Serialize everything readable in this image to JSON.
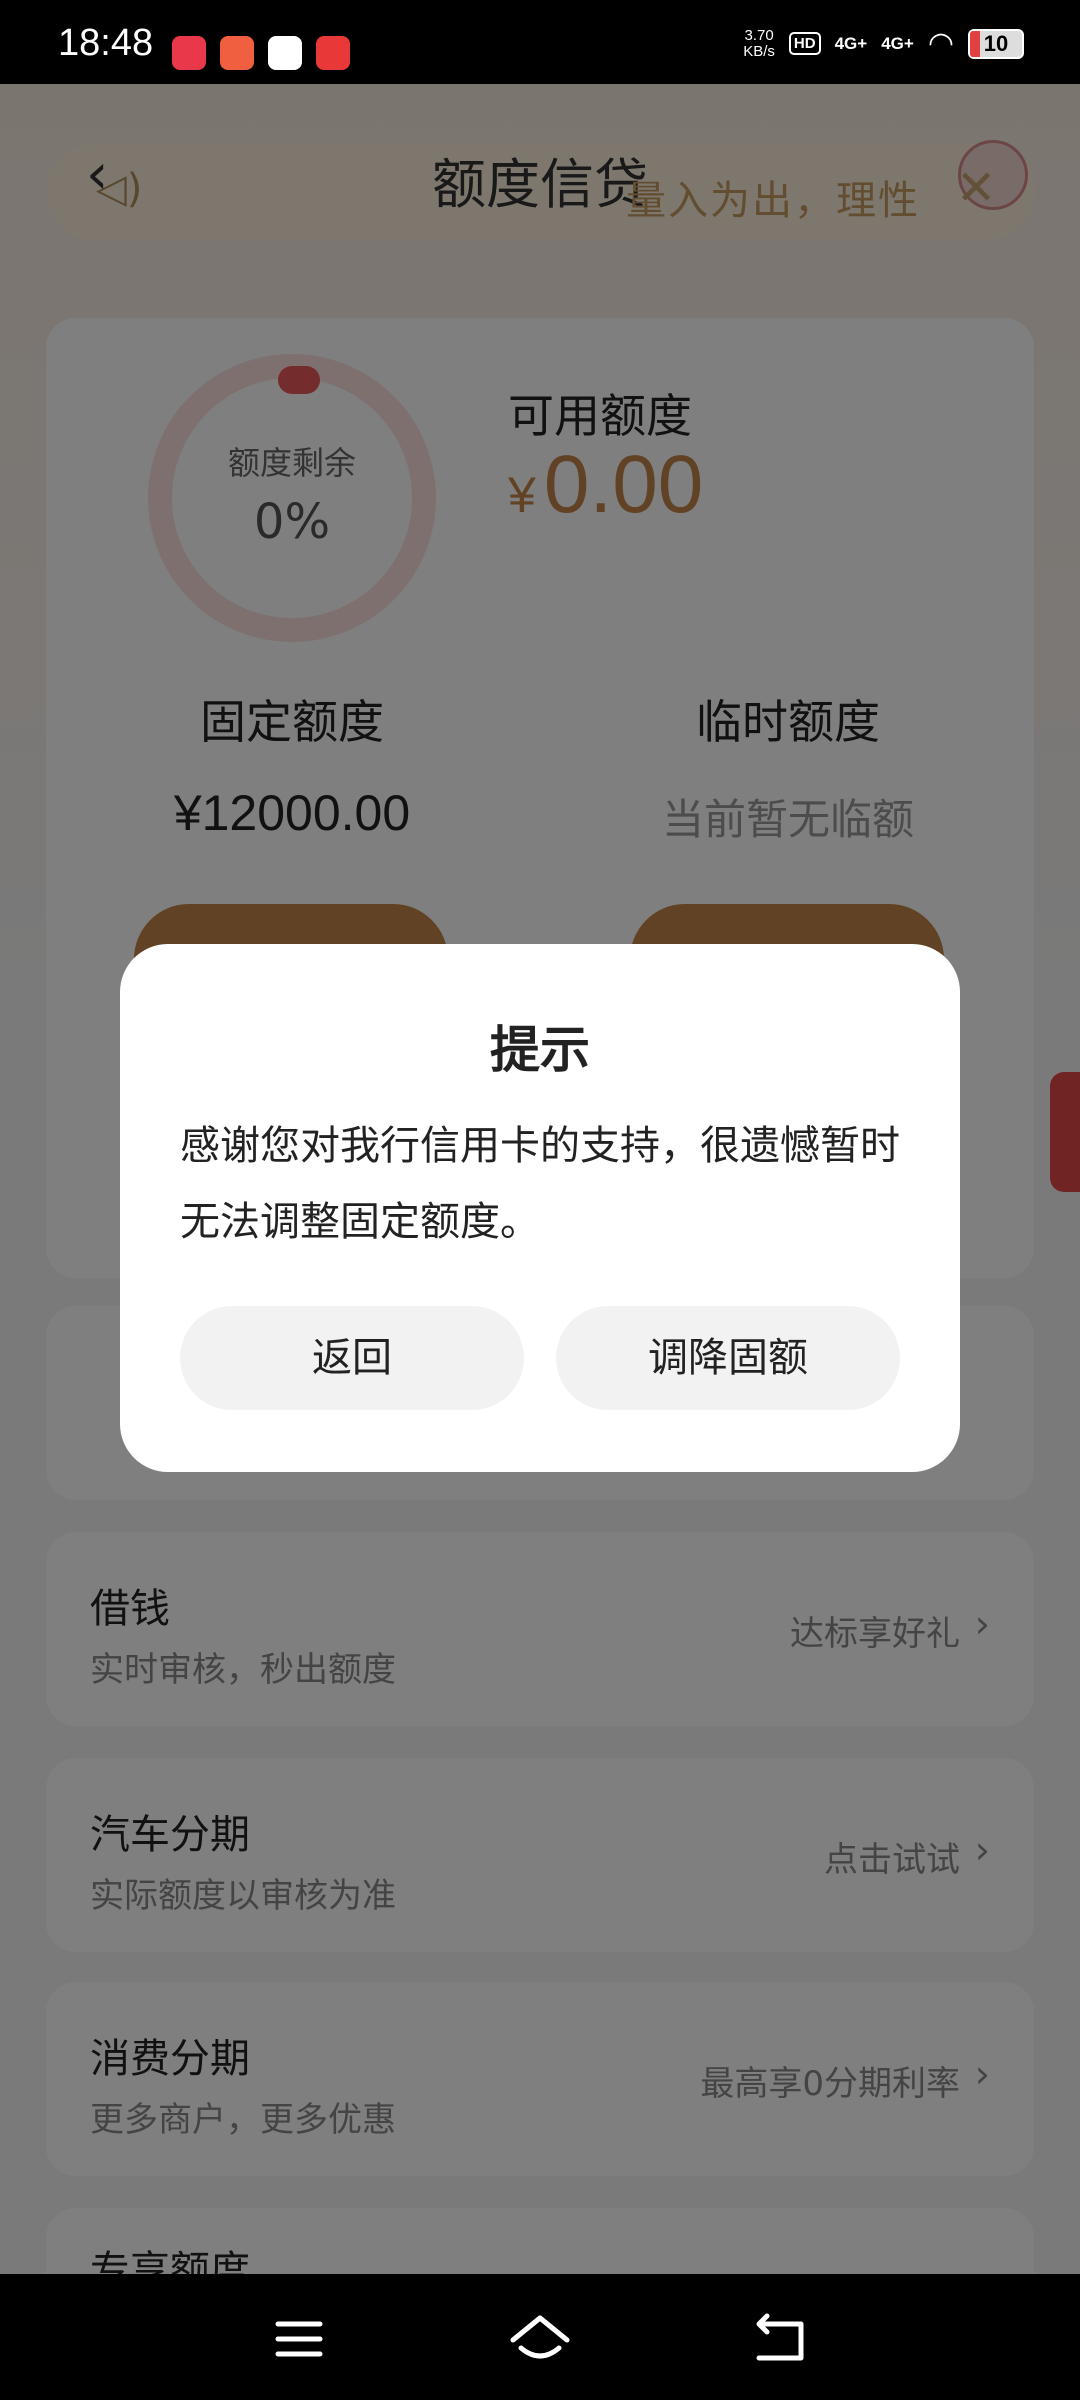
{
  "status_bar": {
    "time": "18:48",
    "speed_value": "3.70",
    "speed_unit": "KB/s",
    "hd": "HD",
    "network1": "4G+",
    "network2": "4G+",
    "battery": "10"
  },
  "header": {
    "title": "额度信贷",
    "banner_text": "量入为出，理性"
  },
  "quota": {
    "ring_label": "额度剩余",
    "ring_value": "0%",
    "available_label": "可用额度",
    "available_currency": "¥",
    "available_value": "0.00",
    "fixed_label": "固定额度",
    "fixed_value": "¥12000.00",
    "temp_label": "临时额度",
    "temp_value": "当前暂无临额"
  },
  "list": [
    {
      "title": "借钱",
      "subtitle": "实时审核，秒出额度",
      "right": "达标享好礼"
    },
    {
      "title": "汽车分期",
      "subtitle": "实际额度以审核为准",
      "right": "点击试试"
    },
    {
      "title": "消费分期",
      "subtitle": "更多商户，更多优惠",
      "right": "最高享0分期利率"
    },
    {
      "title": "专享额度"
    }
  ],
  "dialog": {
    "title": "提示",
    "message": "感谢您对我行信用卡的支持，很遗憾暂时无法调整固定额度。",
    "back_label": "返回",
    "lower_label": "调降固额"
  },
  "colors": {
    "accent": "#c4854a",
    "ring": "#e85858"
  }
}
